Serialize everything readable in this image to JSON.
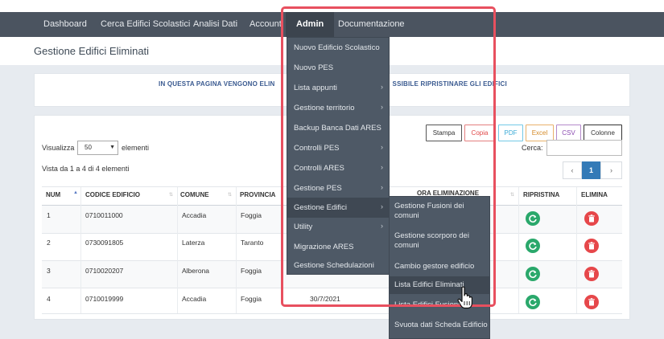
{
  "nav": {
    "items": [
      "Dashboard",
      "Cerca Edifici Scolastici",
      "Analisi Dati",
      "Account",
      "Admin",
      "Documentazione"
    ]
  },
  "page": {
    "title": "Gestione Edifici Eliminati",
    "info_left": "IN QUESTA PAGINA VENGONO ELIN",
    "info_right": "SSIBILE RIPRISTINARE GLI EDIFICI"
  },
  "toolbar": {
    "buttons": [
      "Stampa",
      "Copia",
      "PDF",
      "Excel",
      "CSV",
      "Colonne"
    ],
    "show_label": "Visualizza",
    "show_value": "50",
    "show_suffix": "elementi",
    "search_label": "Cerca:",
    "summary": "Vista da 1 a 4 di 4 elementi"
  },
  "pagination": {
    "prev": "‹",
    "current": "1",
    "next": "›"
  },
  "table": {
    "headers": [
      "NUM",
      "CODICE EDIFICIO",
      "COMUNE",
      "PROVINCIA",
      "ORA ELIMINAZIONE",
      "RIPRISTINA",
      "ELIMINA"
    ],
    "rows": [
      {
        "num": "1",
        "codice": "0710011000",
        "comune": "Accadia",
        "provincia": "Foggia",
        "data": ""
      },
      {
        "num": "2",
        "codice": "0730091805",
        "comune": "Laterza",
        "provincia": "Taranto",
        "data": ""
      },
      {
        "num": "3",
        "codice": "0710020207",
        "comune": "Alberona",
        "provincia": "Foggia",
        "data": ""
      },
      {
        "num": "4",
        "codice": "0710019999",
        "comune": "Accadia",
        "provincia": "Foggia",
        "data": "30/7/2021"
      }
    ]
  },
  "admin_menu": {
    "items": [
      "Nuovo Edificio Scolastico",
      "Nuovo PES",
      "Lista appunti",
      "Gestione territorio",
      "Backup Banca Dati ARES",
      "Controlli PES",
      "Controlli ARES",
      "Gestione PES",
      "Gestione Edifici",
      "Utility",
      "Migrazione ARES",
      "Gestione Schedulazioni"
    ]
  },
  "submenu": {
    "items": [
      "Gestione Fusioni dei comuni",
      "Gestione scorporo dei comuni",
      "Cambio gestore edificio",
      "Lista Edifici Eliminati",
      "Lista Edifici Fusioni",
      "Svuota dati Scheda Edificio"
    ]
  },
  "colors": {
    "nav": "#4b5460",
    "accent": "#337ab7",
    "highlight": "#e8505f",
    "restore": "#2aa86b",
    "delete": "#e6474a"
  }
}
